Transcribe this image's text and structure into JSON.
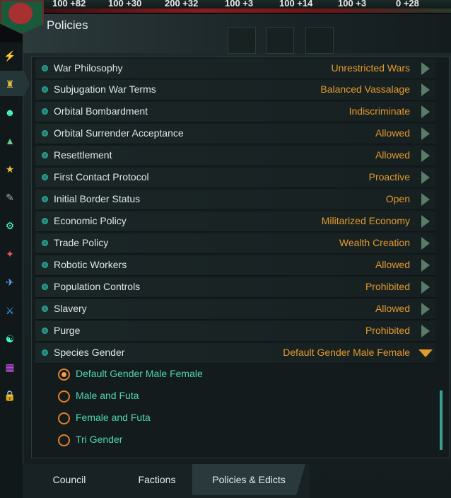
{
  "resources": [
    "100 +82",
    "100 +30",
    "200 +32",
    "100 +3",
    "100 +14",
    "100 +3",
    "0 +28"
  ],
  "window": {
    "title": "Policies"
  },
  "policies": [
    {
      "name": "War Philosophy",
      "value": "Unrestricted Wars"
    },
    {
      "name": "Subjugation War Terms",
      "value": "Balanced Vassalage"
    },
    {
      "name": "Orbital Bombardment",
      "value": "Indiscriminate"
    },
    {
      "name": "Orbital Surrender Acceptance",
      "value": "Allowed"
    },
    {
      "name": "Resettlement",
      "value": "Allowed"
    },
    {
      "name": "First Contact Protocol",
      "value": "Proactive"
    },
    {
      "name": "Initial Border Status",
      "value": "Open"
    },
    {
      "name": "Economic Policy",
      "value": "Militarized Economy"
    },
    {
      "name": "Trade Policy",
      "value": "Wealth Creation"
    },
    {
      "name": "Robotic Workers",
      "value": "Allowed"
    },
    {
      "name": "Population Controls",
      "value": "Prohibited"
    },
    {
      "name": "Slavery",
      "value": "Allowed"
    },
    {
      "name": "Purge",
      "value": "Prohibited"
    },
    {
      "name": "Species Gender",
      "value": "Default Gender Male Female"
    }
  ],
  "gender_options": [
    {
      "label": "Default Gender Male Female",
      "selected": true
    },
    {
      "label": "Male and Futa",
      "selected": false
    },
    {
      "label": "Female and Futa",
      "selected": false
    },
    {
      "label": "Tri Gender",
      "selected": false
    }
  ],
  "tabs": [
    {
      "label": "Council",
      "active": false
    },
    {
      "label": "Factions",
      "active": false
    },
    {
      "label": "Policies & Edicts",
      "active": true
    }
  ],
  "sidebar_icons": [
    "energy-icon",
    "policies-icon",
    "species-icon",
    "planets-icon",
    "leaders-icon",
    "traditions-icon",
    "technology-icon",
    "ascension-icon",
    "fleet-icon",
    "armies-icon",
    "relations-icon",
    "market-icon",
    "lock-icon"
  ],
  "colors": {
    "accent_orange": "#e39a2d",
    "accent_teal": "#4fd6b4",
    "panel": "#141b1c"
  }
}
